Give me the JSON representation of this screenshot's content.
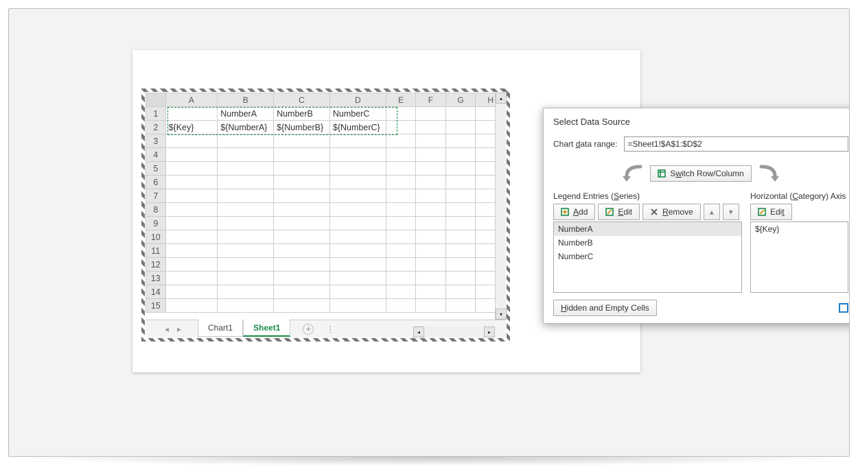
{
  "spreadsheet": {
    "columns": [
      "A",
      "B",
      "C",
      "D",
      "E",
      "F",
      "G",
      "H"
    ],
    "rowcount": 15,
    "cells": {
      "r1": [
        "",
        "NumberA",
        "NumberB",
        "NumberC",
        "",
        "",
        "",
        ""
      ],
      "r2": [
        "${Key}",
        "${NumberA}",
        "${NumberB}",
        "${NumberC}",
        "",
        "",
        "",
        ""
      ]
    },
    "tabs": {
      "chart": "Chart1",
      "sheet": "Sheet1"
    },
    "nav": {
      "prev": "◂",
      "next": "▸",
      "new": "+"
    },
    "scroll": {
      "up": "▴",
      "down": "▾",
      "left": "◂",
      "right": "▸"
    }
  },
  "dialog": {
    "title": "Select Data Source",
    "range_label_pre": "Chart ",
    "range_label_u": "d",
    "range_label_post": "ata range:",
    "range_value": "=Sheet1!$A$1:$D$2",
    "switch_pre": "S",
    "switch_u": "w",
    "switch_post": "itch Row/Column",
    "legend_label_pre": "Legend Entries (",
    "legend_label_u": "S",
    "legend_label_post": "eries)",
    "horiz_label_pre": "Horizontal (",
    "horiz_label_u": "C",
    "horiz_label_post": "ategory) Axis",
    "btn_add_u": "A",
    "btn_add_post": "dd",
    "btn_edit1_u": "E",
    "btn_edit1_post": "dit",
    "btn_remove_u": "R",
    "btn_remove_post": "emove",
    "btn_edit2_pre": "Edi",
    "btn_edit2_u": "t",
    "up": "▴",
    "down": "▾",
    "series": [
      "NumberA",
      "NumberB",
      "NumberC"
    ],
    "categories": [
      "${Key}"
    ],
    "hidden_btn_u": "H",
    "hidden_btn_post": "idden and Empty Cells"
  }
}
